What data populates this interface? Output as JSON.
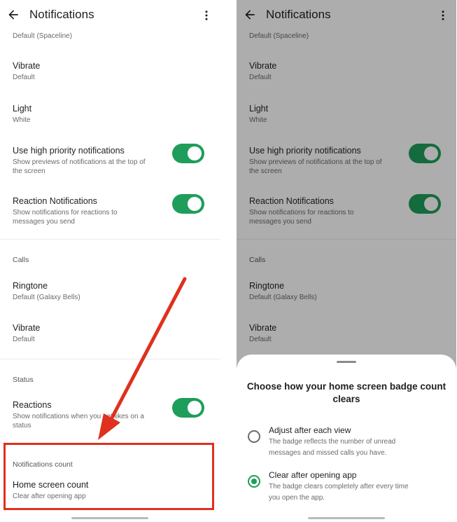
{
  "left": {
    "appbar": {
      "title": "Notifications"
    },
    "top_partial": "Default (Spaceline)",
    "vibrate": {
      "title": "Vibrate",
      "subtitle": "Default"
    },
    "light": {
      "title": "Light",
      "subtitle": "White"
    },
    "high_priority": {
      "title": "Use high priority notifications",
      "subtitle": "Show previews of notifications at the top of the screen",
      "enabled": true
    },
    "reaction_notifications": {
      "title": "Reaction Notifications",
      "subtitle": "Show notifications for reactions to messages you send",
      "enabled": true
    },
    "calls_section": "Calls",
    "ringtone": {
      "title": "Ringtone",
      "subtitle": "Default (Galaxy Bells)"
    },
    "calls_vibrate": {
      "title": "Vibrate",
      "subtitle": "Default"
    },
    "status_section": "Status",
    "reactions": {
      "title": "Reactions",
      "subtitle": "Show notifications when you get likes on a status",
      "enabled": true
    },
    "notifications_count_section": "Notifications count",
    "home_screen_count": {
      "title": "Home screen count",
      "subtitle": "Clear after opening app"
    }
  },
  "right": {
    "appbar": {
      "title": "Notifications"
    },
    "top_partial": "Default (Spaceline)",
    "vibrate": {
      "title": "Vibrate",
      "subtitle": "Default"
    },
    "light": {
      "title": "Light",
      "subtitle": "White"
    },
    "high_priority": {
      "title": "Use high priority notifications",
      "subtitle": "Show previews of notifications at the top of the screen",
      "enabled": true
    },
    "reaction_notifications": {
      "title": "Reaction Notifications",
      "subtitle": "Show notifications for reactions to messages you send",
      "enabled": true
    },
    "calls_section": "Calls",
    "ringtone": {
      "title": "Ringtone",
      "subtitle": "Default (Galaxy Bells)"
    },
    "calls_vibrate": {
      "title": "Vibrate",
      "subtitle": "Default"
    },
    "sheet": {
      "title": "Choose how your home screen badge count clears",
      "options": [
        {
          "label": "Adjust after each view",
          "description": "The badge reflects the number of unread messages and missed calls you have.",
          "selected": false
        },
        {
          "label": "Clear after opening app",
          "description": "The badge clears completely after every time you open the app.",
          "selected": true
        }
      ]
    }
  },
  "icons": {
    "back": "arrow-back-icon",
    "more": "more-vert-icon",
    "radio": "radio-button-icon"
  },
  "colors": {
    "toggle_on": "#1e9e5a",
    "annotation": "#e0301e",
    "scrim": "rgba(0,0,0,0.32)"
  }
}
